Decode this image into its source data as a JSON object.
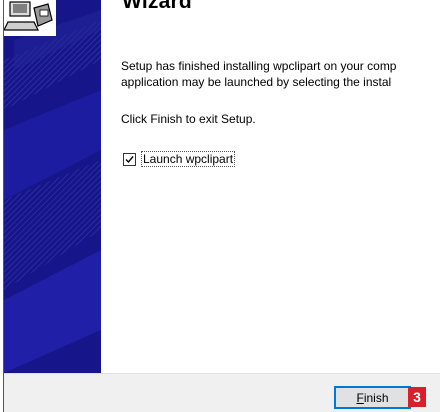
{
  "wizard": {
    "title": "Wizard",
    "finished_line1": "Setup has finished installing wpclipart on your comp",
    "finished_line2": "application may be launched by selecting the instal",
    "exit_text": "Click Finish to exit Setup.",
    "launch_checkbox": {
      "label": "Launch wpclipart",
      "checked": true
    }
  },
  "footer": {
    "finish_button": {
      "label_accel": "F",
      "label_rest": "inish"
    },
    "step_badge": "3"
  },
  "colors": {
    "sidebar": "#16168a",
    "button_focus": "#0078d7",
    "badge": "#d6202b"
  }
}
